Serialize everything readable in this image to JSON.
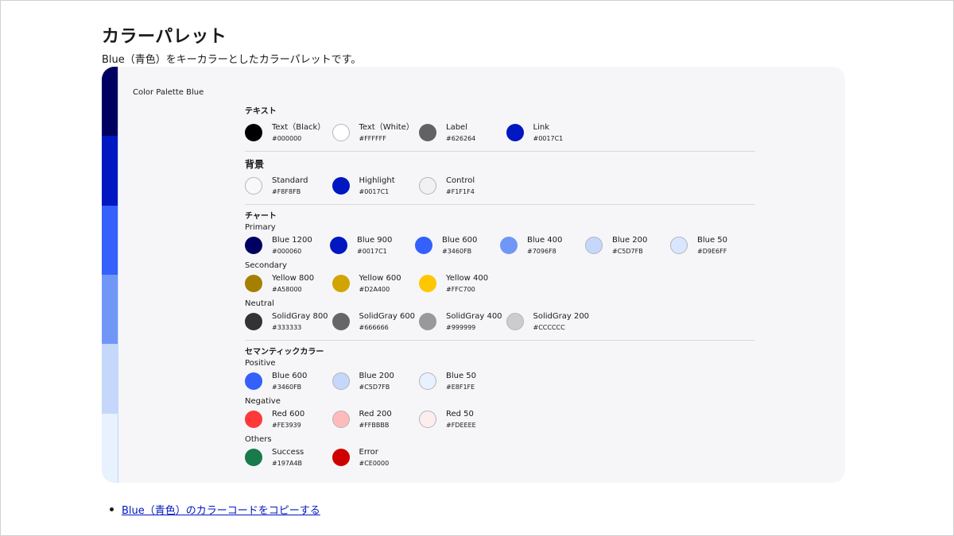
{
  "page": {
    "title": "カラーパレット",
    "intro": "Blue（青色）をキーカラーとしたカラーパレットです。",
    "link_label": "Blue（青色）のカラーコードをコピーする"
  },
  "card": {
    "title": "Color Palette Blue",
    "stripe_colors": [
      "#000060",
      "#0017C1",
      "#3460FB",
      "#7096F8",
      "#C5D7FB",
      "#E8F1FE"
    ]
  },
  "sections": {
    "text": {
      "title": "テキスト",
      "items": [
        {
          "name": "Text（Black）",
          "hex": "#000000"
        },
        {
          "name": "Text（White）",
          "hex": "#FFFFFF"
        },
        {
          "name": "Label",
          "hex": "#626264"
        },
        {
          "name": "Link",
          "hex": "#0017C1"
        }
      ]
    },
    "background": {
      "title": "背景",
      "items": [
        {
          "name": "Standard",
          "hex": "#F8F8FB"
        },
        {
          "name": "Highlight",
          "hex": "#0017C1"
        },
        {
          "name": "Control",
          "hex": "#F1F1F4"
        }
      ]
    },
    "chart": {
      "title": "チャート",
      "primary": {
        "title": "Primary",
        "items": [
          {
            "name": "Blue 1200",
            "hex": "#000060"
          },
          {
            "name": "Blue 900",
            "hex": "#0017C1"
          },
          {
            "name": "Blue 600",
            "hex": "#3460FB"
          },
          {
            "name": "Blue 400",
            "hex": "#7096F8"
          },
          {
            "name": "Blue 200",
            "hex": "#C5D7FB"
          },
          {
            "name": "Blue 50",
            "hex": "#D9E6FF"
          }
        ]
      },
      "secondary": {
        "title": "Secondary",
        "items": [
          {
            "name": "Yellow 800",
            "hex": "#A58000"
          },
          {
            "name": "Yellow 600",
            "hex": "#D2A400"
          },
          {
            "name": "Yellow 400",
            "hex": "#FFC700"
          }
        ]
      },
      "neutral": {
        "title": "Neutral",
        "items": [
          {
            "name": "SolidGray 800",
            "hex": "#333333"
          },
          {
            "name": "SolidGray 600",
            "hex": "#666666"
          },
          {
            "name": "SolidGray 400",
            "hex": "#999999"
          },
          {
            "name": "SolidGray 200",
            "hex": "#CCCCCC"
          }
        ]
      }
    },
    "semantic": {
      "title": "セマンティックカラー",
      "positive": {
        "title": "Positive",
        "items": [
          {
            "name": "Blue 600",
            "hex": "#3460FB"
          },
          {
            "name": "Blue 200",
            "hex": "#C5D7FB"
          },
          {
            "name": "Blue 50",
            "hex": "#E8F1FE"
          }
        ]
      },
      "negative": {
        "title": "Negative",
        "items": [
          {
            "name": "Red 600",
            "hex": "#FE3939"
          },
          {
            "name": "Red 200",
            "hex": "#FFBBBB"
          },
          {
            "name": "Red 50",
            "hex": "#FDEEEE"
          }
        ]
      },
      "others": {
        "title": "Others",
        "items": [
          {
            "name": "Success",
            "hex": "#197A4B"
          },
          {
            "name": "Error",
            "hex": "#CE0000"
          }
        ]
      }
    }
  }
}
